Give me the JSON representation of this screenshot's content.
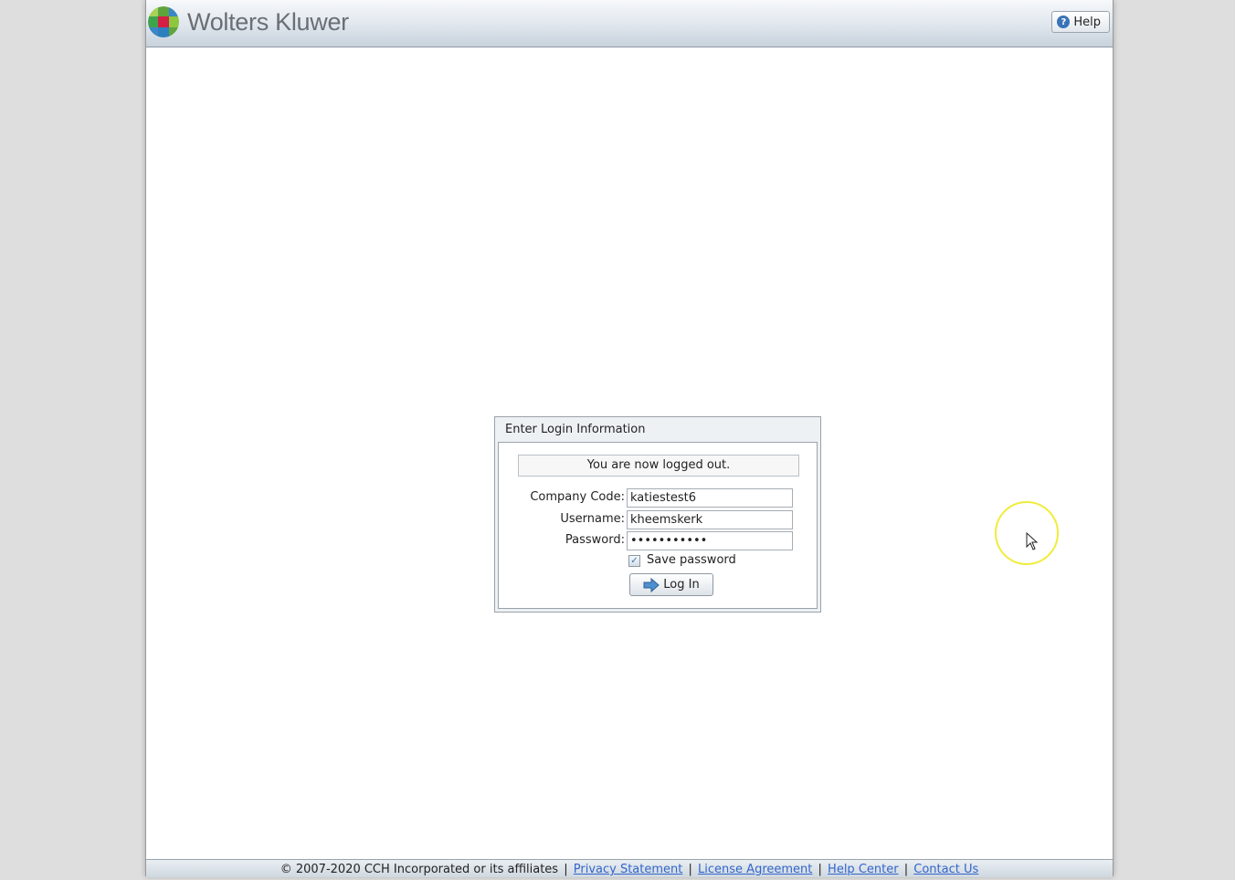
{
  "header": {
    "brand": "Wolters Kluwer",
    "help_label": "Help",
    "help_icon": "question-icon"
  },
  "login": {
    "title": "Enter Login Information",
    "status_message": "You are now logged out.",
    "company_code_label": "Company Code:",
    "company_code_value": "katiestest6",
    "username_label": "Username:",
    "username_value": "kheemskerk",
    "password_label": "Password:",
    "password_value": "•••••••••••",
    "save_password_label": "Save password",
    "save_password_checked": true,
    "login_button": "Log In",
    "login_icon": "arrow-right-icon"
  },
  "footer": {
    "copyright": "© 2007-2020 CCH Incorporated or its affiliates",
    "links": [
      "Privacy Statement",
      "License Agreement",
      "Help Center",
      "Contact Us"
    ]
  },
  "colors": {
    "link": "#3366cc",
    "cursor_highlight": "#f0ec3a",
    "logo_green": "#5fa43c",
    "logo_blue": "#3a86c8",
    "logo_red": "#d31f45"
  }
}
